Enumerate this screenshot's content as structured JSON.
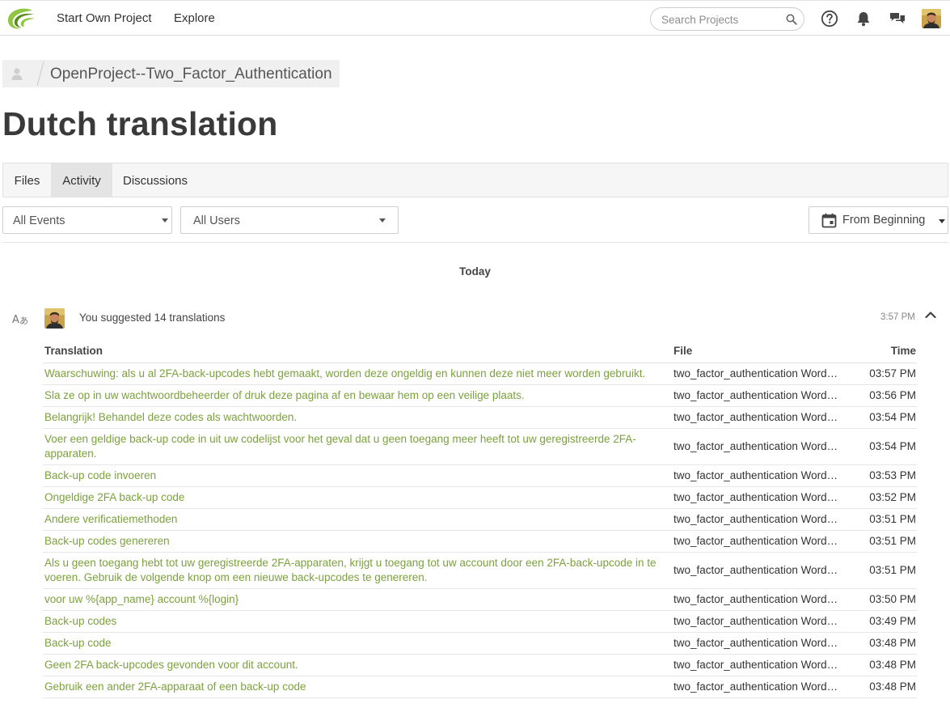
{
  "nav": {
    "start_project": "Start Own Project",
    "explore": "Explore",
    "search_placeholder": "Search Projects",
    "icons": [
      "logo-icon",
      "search-icon",
      "help-icon",
      "bell-icon",
      "chat-icon",
      "avatar"
    ]
  },
  "breadcrumb": {
    "project": "OpenProject--Two_Factor_Authentication"
  },
  "page": {
    "title": "Dutch translation"
  },
  "tabs": [
    {
      "label": "Files",
      "active": false
    },
    {
      "label": "Activity",
      "active": true
    },
    {
      "label": "Discussions",
      "active": false
    }
  ],
  "filters": {
    "events": "All Events",
    "users": "All Users",
    "date": "From Beginning"
  },
  "day_label": "Today",
  "activity": {
    "summary": "You suggested 14 translations",
    "time": "3:57 PM",
    "columns": {
      "translation": "Translation",
      "file": "File",
      "time": "Time"
    },
    "rows": [
      {
        "translation": "Waarschuwing: als u al 2FA-back-upcodes hebt gemaakt, worden deze ongeldig en kunnen deze niet meer worden gebruikt.",
        "file": "two_factor_authentication Word…",
        "time": "03:57 PM"
      },
      {
        "translation": "Sla ze op in uw wachtwoordbeheerder of druk deze pagina af en bewaar hem op een veilige plaats.",
        "file": "two_factor_authentication Word…",
        "time": "03:56 PM"
      },
      {
        "translation": "Belangrijk! Behandel deze codes als wachtwoorden.",
        "file": "two_factor_authentication Word…",
        "time": "03:54 PM"
      },
      {
        "translation": "Voer een geldige back-up code in uit uw codelijst voor het geval dat u geen toegang meer heeft tot uw geregistreerde 2FA-apparaten.",
        "file": "two_factor_authentication Word…",
        "time": "03:54 PM"
      },
      {
        "translation": "Back-up code invoeren",
        "file": "two_factor_authentication Word…",
        "time": "03:53 PM"
      },
      {
        "translation": "Ongeldige 2FA back-up code",
        "file": "two_factor_authentication Word…",
        "time": "03:52 PM"
      },
      {
        "translation": "Andere verificatiemethoden",
        "file": "two_factor_authentication Word…",
        "time": "03:51 PM"
      },
      {
        "translation": "Back-up codes genereren",
        "file": "two_factor_authentication Word…",
        "time": "03:51 PM"
      },
      {
        "translation": "Als u geen toegang hebt tot uw geregistreerde 2FA-apparaten, krijgt u toegang tot uw account door een 2FA-back-upcode in te voeren. Gebruik de volgende knop om een nieuwe back-upcodes te genereren.",
        "file": "two_factor_authentication Word…",
        "time": "03:51 PM"
      },
      {
        "translation": "voor uw %{app_name} account %{login}",
        "file": "two_factor_authentication Word…",
        "time": "03:50 PM"
      },
      {
        "translation": "Back-up codes",
        "file": "two_factor_authentication Word…",
        "time": "03:49 PM"
      },
      {
        "translation": "Back-up code",
        "file": "two_factor_authentication Word…",
        "time": "03:48 PM"
      },
      {
        "translation": "Geen 2FA back-upcodes gevonden voor dit account.",
        "file": "two_factor_authentication Word…",
        "time": "03:48 PM"
      },
      {
        "translation": "Gebruik een ander 2FA-apparaat of een back-up code",
        "file": "two_factor_authentication Word…",
        "time": "03:48 PM"
      }
    ]
  },
  "colors": {
    "link_green": "#7ba23d",
    "logo_green": "#8dc63f"
  }
}
